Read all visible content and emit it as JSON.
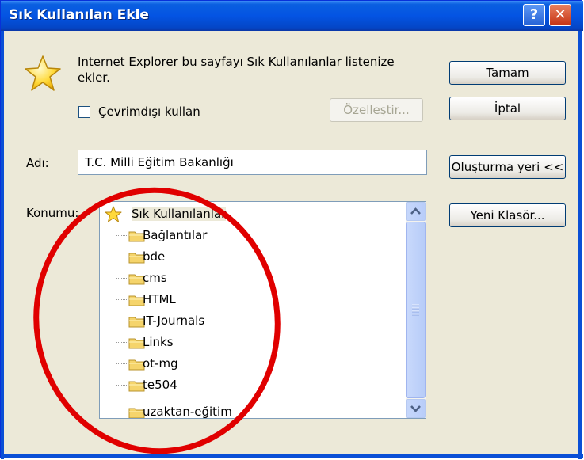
{
  "window": {
    "title": "Sık Kullanılan Ekle",
    "help_glyph": "?",
    "close_glyph": "✕"
  },
  "description": "Internet Explorer bu sayfayı Sık Kullanılanlar listenize ekler.",
  "offline_checkbox": {
    "label": "Çevrimdışı kullan",
    "checked": false
  },
  "buttons": {
    "ok": "Tamam",
    "cancel": "İptal",
    "customize": "Özelleştir...",
    "create_in": "Oluşturma yeri <<",
    "new_folder": "Yeni Klasör..."
  },
  "name_field": {
    "label": "Adı:",
    "value": "T.C. Milli Eğitim Bakanlığı"
  },
  "location": {
    "label": "Konumu:",
    "root": "Sık Kullanılanlar",
    "folders": [
      "Bağlantılar",
      "bde",
      "cms",
      "HTML",
      "IT-Journals",
      "Links",
      "ot-mg",
      "te504",
      "uzaktan-eğitim"
    ]
  },
  "colors": {
    "titlebar": "#0454e3",
    "dialog_bg": "#ece9d8",
    "annotation_circle": "#e00000",
    "folder": "#f5d46b"
  }
}
